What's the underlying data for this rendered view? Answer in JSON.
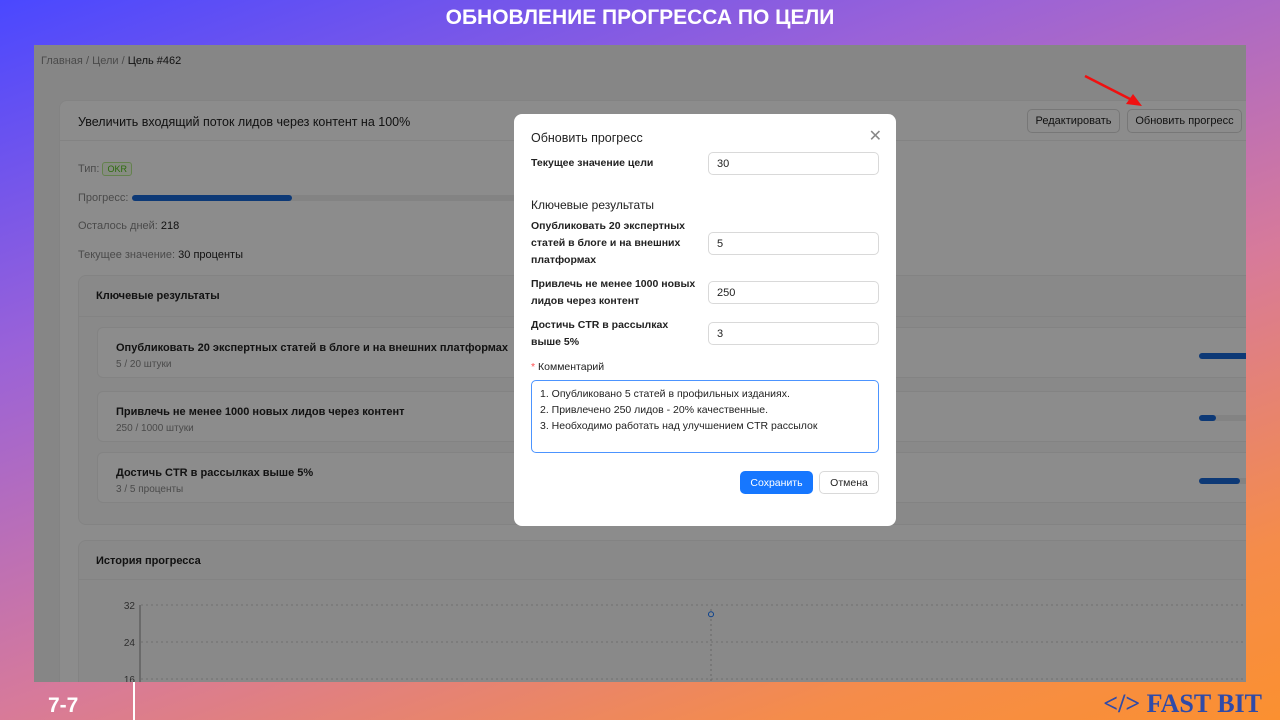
{
  "slide": {
    "title": "ОБНОВЛЕНИЕ ПРОГРЕССА ПО ЦЕЛИ",
    "page": "7-7",
    "brand": "</> FAST BIT"
  },
  "breadcrumb": [
    "Главная",
    "/",
    "Цели",
    "/",
    "Цель #462"
  ],
  "goal": {
    "title": "Увеличить входящий поток лидов через контент на 100%",
    "edit_label": "Редактировать",
    "update_label": "Обновить прогресс",
    "type_label": "Тип:",
    "type": "OKR",
    "progress_label": "Прогресс:",
    "progress_percent": 30,
    "days_label": "Осталось дней:",
    "days": "218",
    "current_label": "Текущее значение:",
    "current": "30 проценты"
  },
  "key_results": {
    "title": "Ключевые результаты",
    "items": [
      {
        "title": "Опубликовать 20 экспертных статей в блоге и на внешних платформах",
        "sub": "5 / 20 штуки",
        "percent": 25
      },
      {
        "title": "Привлечь не менее 1000 новых лидов через контент",
        "sub": "250 / 1000 штуки",
        "percent": 25
      },
      {
        "title": "Достичь CTR в рассылках выше 5%",
        "sub": "3 / 5 проценты",
        "percent": 60
      }
    ]
  },
  "history": {
    "title": "История прогресса",
    "yticks": [
      "32",
      "24",
      "16"
    ],
    "points": [
      30
    ]
  },
  "modal": {
    "title": "Обновить прогресс",
    "current_label": "Текущее значение цели",
    "current_value": "30",
    "kr_title": "Ключевые результаты",
    "kr": [
      {
        "label": "Опубликовать 20 экспертных статей в блоге и на внешних платформах",
        "value": "5"
      },
      {
        "label": "Привлечь не менее 1000 новых лидов через контент",
        "value": "250"
      },
      {
        "label": "Достичь CTR в рассылках выше 5%",
        "value": "3"
      }
    ],
    "required_mark": "*",
    "comment_label": "Комментарий",
    "comment": "1. Опубликовано 5 статей в профильных изданиях.\n2. Привлечено 250 лидов - 20% качественные.\n3. Необходимо работать над улучшением CTR рассылок",
    "save": "Сохранить",
    "cancel": "Отмена"
  }
}
